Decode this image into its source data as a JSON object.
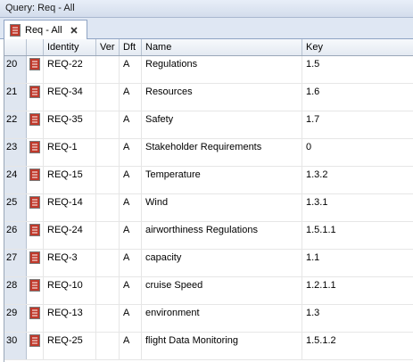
{
  "window": {
    "title": "Query: Req - All"
  },
  "tab": {
    "label": "Req - All",
    "icon": "query-document-icon",
    "close_icon": "close-icon"
  },
  "columns": [
    "",
    "",
    "Identity",
    "Ver",
    "Dft",
    "Name",
    "Key"
  ],
  "row_icon": "requirement-icon",
  "rows": [
    {
      "num": "20",
      "identity": "REQ-22",
      "ver": "",
      "dft": "A",
      "name": "Regulations",
      "key": "1.5"
    },
    {
      "num": "21",
      "identity": "REQ-34",
      "ver": "",
      "dft": "A",
      "name": "Resources",
      "key": "1.6"
    },
    {
      "num": "22",
      "identity": "REQ-35",
      "ver": "",
      "dft": "A",
      "name": "Safety",
      "key": "1.7"
    },
    {
      "num": "23",
      "identity": "REQ-1",
      "ver": "",
      "dft": "A",
      "name": "Stakeholder Requirements",
      "key": "0"
    },
    {
      "num": "24",
      "identity": "REQ-15",
      "ver": "",
      "dft": "A",
      "name": "Temperature",
      "key": "1.3.2"
    },
    {
      "num": "25",
      "identity": "REQ-14",
      "ver": "",
      "dft": "A",
      "name": "Wind",
      "key": "1.3.1"
    },
    {
      "num": "26",
      "identity": "REQ-24",
      "ver": "",
      "dft": "A",
      "name": "airworthiness Regulations",
      "key": "1.5.1.1"
    },
    {
      "num": "27",
      "identity": "REQ-3",
      "ver": "",
      "dft": "A",
      "name": "capacity",
      "key": "1.1"
    },
    {
      "num": "28",
      "identity": "REQ-10",
      "ver": "",
      "dft": "A",
      "name": "cruise Speed",
      "key": "1.2.1.1"
    },
    {
      "num": "29",
      "identity": "REQ-13",
      "ver": "",
      "dft": "A",
      "name": "environment",
      "key": "1.3"
    },
    {
      "num": "30",
      "identity": "REQ-25",
      "ver": "",
      "dft": "A",
      "name": "flight Data Monitoring",
      "key": "1.5.1.2"
    }
  ]
}
